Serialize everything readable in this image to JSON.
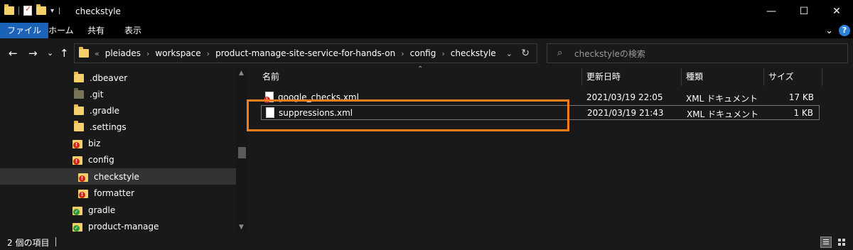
{
  "window": {
    "title": "checkstyle",
    "minimize_glyph": "—",
    "maximize_glyph": "☐",
    "close_glyph": "✕",
    "qat_sep_glyph": "|",
    "qat_arrow_glyph": "▾"
  },
  "ribbon": {
    "tabs": [
      {
        "label": "ファイル",
        "active": true
      },
      {
        "label": "ホーム",
        "active": false
      },
      {
        "label": "共有",
        "active": false
      },
      {
        "label": "表示",
        "active": false
      }
    ],
    "expand_glyph": "⌄",
    "help_glyph": "?"
  },
  "nav": {
    "back": "←",
    "forward": "→",
    "recent": "⌄",
    "up": "↑"
  },
  "address": {
    "overflow": "«",
    "crumbs": [
      "pleiades",
      "workspace",
      "product-manage-site-service-for-hands-on",
      "config",
      "checkstyle"
    ],
    "separator": "›",
    "dropdown_glyph": "⌄",
    "refresh_glyph": "↻"
  },
  "search": {
    "placeholder": "checkstyleの検索",
    "icon": "search-icon",
    "icon_glyph": "⌕"
  },
  "sidebar": {
    "items": [
      {
        "label": ".dbeaver",
        "icon": "folder-icon",
        "indent": 1
      },
      {
        "label": ".git",
        "icon": "folder-gray-icon",
        "indent": 1
      },
      {
        "label": ".gradle",
        "icon": "folder-icon",
        "indent": 1
      },
      {
        "label": ".settings",
        "icon": "folder-icon",
        "indent": 1
      },
      {
        "label": "biz",
        "icon": "folder-warning-icon",
        "indent": 1
      },
      {
        "label": "config",
        "icon": "folder-warning-icon",
        "indent": 1
      },
      {
        "label": "checkstyle",
        "icon": "folder-warning-icon",
        "indent": 2,
        "selected": true
      },
      {
        "label": "formatter",
        "icon": "folder-warning-icon",
        "indent": 2
      },
      {
        "label": "gradle",
        "icon": "folder-ok-icon",
        "indent": 1
      },
      {
        "label": "product-manage",
        "icon": "folder-ok-icon",
        "indent": 1
      }
    ],
    "scroll_up_glyph": "▲",
    "scroll_down_glyph": "▼"
  },
  "filelist": {
    "columns": {
      "name": "名前",
      "modified": "更新日時",
      "type": "種類",
      "size": "サイズ"
    },
    "sort_glyph": "⌃",
    "rows": [
      {
        "name": "google_checks.xml",
        "modified": "2021/03/19 22:05",
        "type": "XML ドキュメント",
        "size": "17 KB"
      },
      {
        "name": "suppressions.xml",
        "modified": "2021/03/19 21:43",
        "type": "XML ドキュメント",
        "size": "1 KB",
        "selected": true
      }
    ]
  },
  "status": {
    "item_count": "2 個の項目"
  },
  "colors": {
    "accent": "#1a63b8",
    "highlight": "#f07d1e",
    "background": "#191919",
    "warning_badge": "#cc2a1f",
    "ok_badge": "#2b9a3a"
  }
}
